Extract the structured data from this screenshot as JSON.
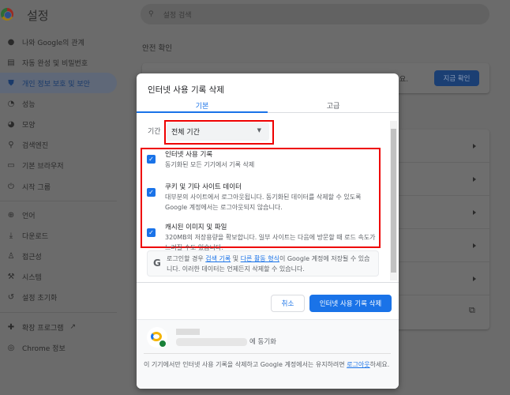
{
  "sidebar": {
    "title": "설정",
    "items": [
      {
        "label": "나와 Google의 관계",
        "icon": "person-icon"
      },
      {
        "label": "자동 완성 및 비밀번호",
        "icon": "clipboard-icon"
      },
      {
        "label": "개인 정보 보호 및 보안",
        "icon": "shield-icon"
      },
      {
        "label": "성능",
        "icon": "speedometer-icon"
      },
      {
        "label": "모양",
        "icon": "palette-icon"
      },
      {
        "label": "검색엔진",
        "icon": "search-icon"
      },
      {
        "label": "기본 브라우저",
        "icon": "browser-icon"
      },
      {
        "label": "시작 그룹",
        "icon": "power-icon"
      },
      {
        "label": "언어",
        "icon": "globe-icon"
      },
      {
        "label": "다운로드",
        "icon": "download-icon"
      },
      {
        "label": "접근성",
        "icon": "accessibility-icon"
      },
      {
        "label": "시스템",
        "icon": "wrench-icon"
      },
      {
        "label": "설정 초기화",
        "icon": "history-icon"
      },
      {
        "label": "확장 프로그램",
        "icon": "puzzle-icon"
      },
      {
        "label": "Chrome 정보",
        "icon": "chrome-icon"
      }
    ]
  },
  "search": {
    "placeholder": "설정 검색"
  },
  "main": {
    "safety_title": "안전 확인",
    "safety_text_tail": "요.",
    "check_now": "지금 확인"
  },
  "dialog": {
    "title": "인터넷 사용 기록 삭제",
    "tabs": [
      "기본",
      "고급"
    ],
    "period_label": "기간",
    "period_value": "전체 기간",
    "items": [
      {
        "title": "인터넷 사용 기록",
        "desc": "동기화된 모든 기기에서 기록 삭제",
        "checked": true
      },
      {
        "title": "쿠키 및 기타 사이트 데이터",
        "desc": "대부분의 사이트에서 로그아웃됩니다. 동기화된 데이터를 삭제할 수 있도록 Google 계정에서는 로그아웃되지 않습니다.",
        "checked": true
      },
      {
        "title": "캐시된 이미지 및 파일",
        "desc": "320MB의 저장용량을 확보합니다. 일부 사이트는 다음에 방문할 때 로드 속도가 느려질 수도 있습니다.",
        "checked": true
      }
    ],
    "google_info": {
      "pre": "로그인할 경우 ",
      "link1": "검색 기록",
      "mid": " 및 ",
      "link2": "다른 활동 형식",
      "post": "이 Google 계정에 저장될 수 있습니다. 이러한 데이터는 언제든지 삭제할 수 있습니다."
    },
    "cancel": "취소",
    "confirm": "인터넷 사용 기록 삭제",
    "sync_suffix": "에 동기화",
    "footer": {
      "pre": "이 기기에서만 인터넷 사용 기록을 삭제하고 Google 계정에서는 유지하려면 ",
      "link": "로그아웃",
      "post": "하세요."
    }
  }
}
